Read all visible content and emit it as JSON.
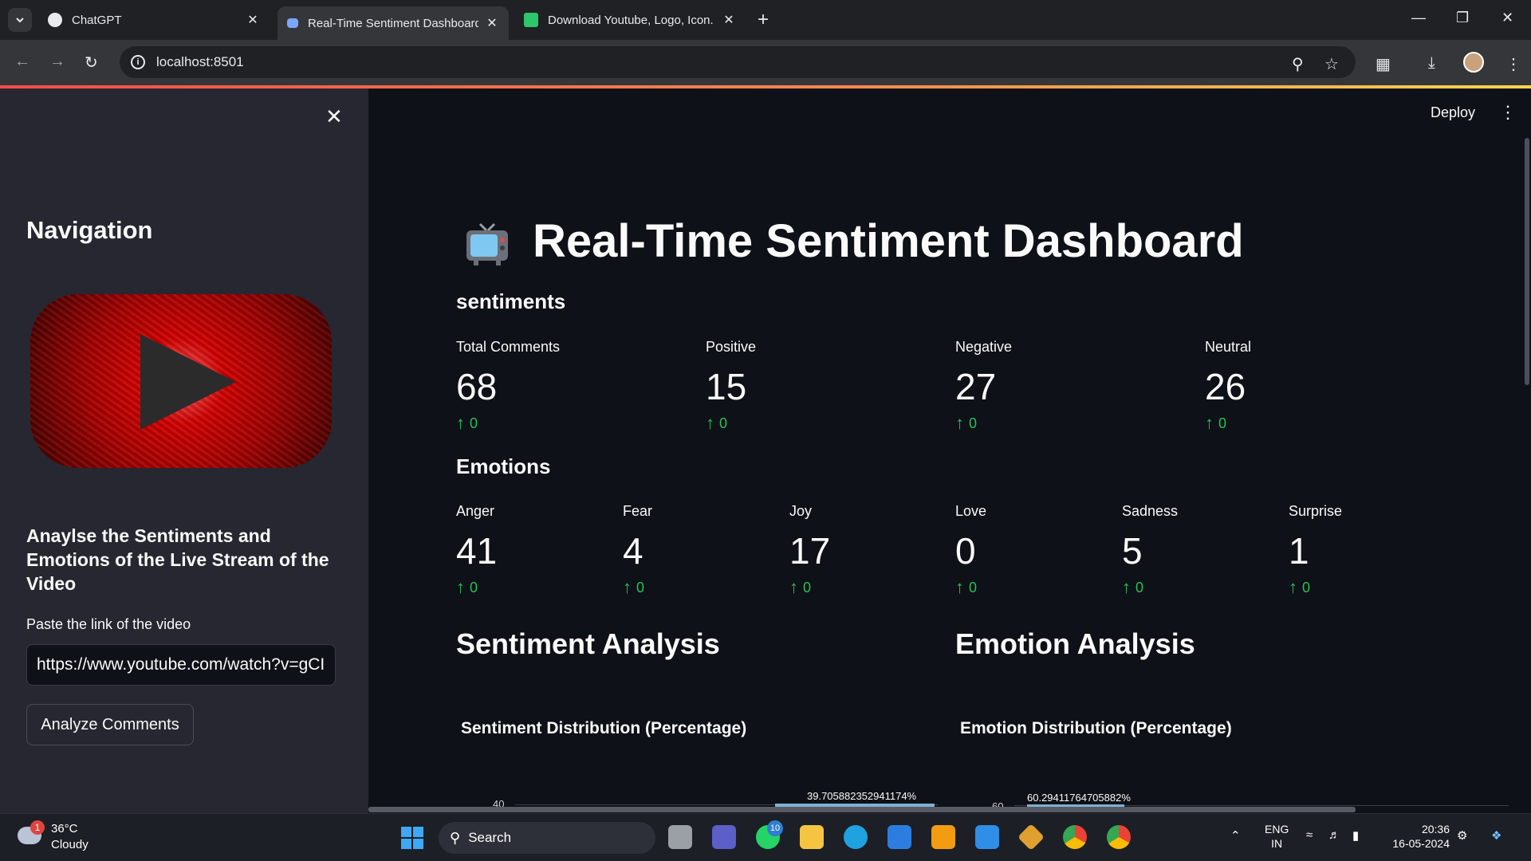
{
  "browser": {
    "tabs": [
      {
        "title": "ChatGPT",
        "favicon": "chatgpt-icon"
      },
      {
        "title": "Real-Time Sentiment Dashboard",
        "favicon": "streamlit-icon",
        "active": true
      },
      {
        "title": "Download Youtube, Logo, Icon.",
        "favicon": "pixabay-icon"
      }
    ],
    "new_tab": "+",
    "url": "localhost:8501",
    "close": "✕"
  },
  "sidebar": {
    "heading": "Navigation",
    "description": "Anaylse the Sentiments and Emotions of the Live Stream of the Video",
    "input_label": "Paste the link of the video",
    "input_value": "https://www.youtube.com/watch?v=gCI",
    "button_label": "Analyze Comments",
    "close": "✕"
  },
  "header": {
    "deploy_label": "Deploy",
    "menu": "⋮"
  },
  "main": {
    "title": "Real-Time Sentiment Dashboard",
    "sentiments_heading": "sentiments",
    "sentiments": [
      {
        "label": "Total Comments",
        "value": "68",
        "delta": "0"
      },
      {
        "label": "Positive",
        "value": "15",
        "delta": "0"
      },
      {
        "label": "Negative",
        "value": "27",
        "delta": "0"
      },
      {
        "label": "Neutral",
        "value": "26",
        "delta": "0"
      }
    ],
    "emotions_heading": "Emotions",
    "emotions": [
      {
        "label": "Anger",
        "value": "41",
        "delta": "0"
      },
      {
        "label": "Fear",
        "value": "4",
        "delta": "0"
      },
      {
        "label": "Joy",
        "value": "17",
        "delta": "0"
      },
      {
        "label": "Love",
        "value": "0",
        "delta": "0"
      },
      {
        "label": "Sadness",
        "value": "5",
        "delta": "0"
      },
      {
        "label": "Surprise",
        "value": "1",
        "delta": "0"
      }
    ],
    "sentiment_analysis_heading": "Sentiment Analysis",
    "emotion_analysis_heading": "Emotion Analysis"
  },
  "chart_data": [
    {
      "type": "bar",
      "title": "Sentiment Distribution (Percentage)",
      "visible_ticks": [
        "40"
      ],
      "visible_annotation": "39.705882352941174%",
      "values": [
        39.705882352941174
      ]
    },
    {
      "type": "bar",
      "title": "Emotion Distribution (Percentage)",
      "visible_ticks": [
        "60"
      ],
      "visible_annotation": "60.29411764705882%",
      "values": [
        60.29411764705882
      ]
    }
  ],
  "taskbar": {
    "weather_temp": "36°C",
    "weather_cond": "Cloudy",
    "weather_badge": "1",
    "search_label": "Search",
    "whatsapp_badge": "10",
    "lang_top": "ENG",
    "lang_bottom": "IN",
    "time": "20:36",
    "date": "16-05-2024"
  },
  "colors": {
    "accent": "#ff4b4b",
    "delta_green": "#21c354",
    "sidebar_bg": "#262730",
    "main_bg": "#0e1117"
  }
}
